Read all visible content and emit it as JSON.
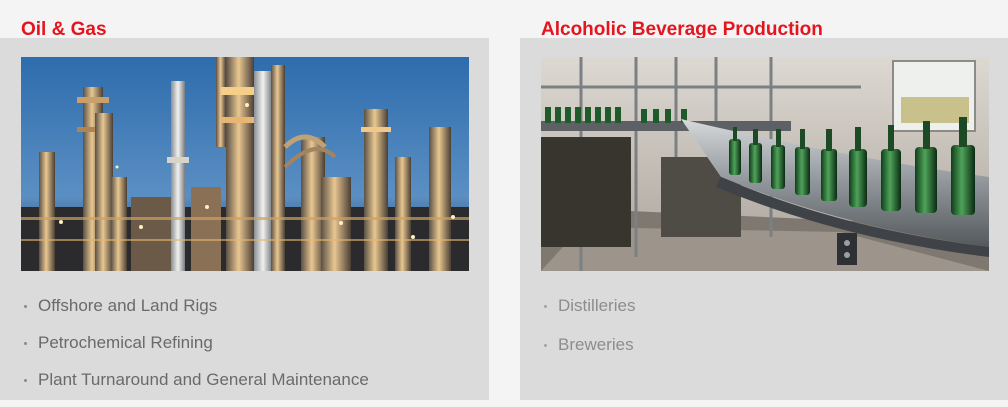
{
  "sections": [
    {
      "title": "Oil & Gas",
      "image_subject": "oil-refinery-at-dusk",
      "items": [
        "Offshore and Land Rigs",
        "Petrochemical Refining",
        "Plant Turnaround and General Maintenance"
      ]
    },
    {
      "title": "Alcoholic Beverage Production",
      "image_subject": "bottling-line-conveyor",
      "items": [
        "Distilleries",
        "Breweries"
      ]
    }
  ],
  "colors": {
    "accent": "#e4151f",
    "card_background": "#dbdbdb",
    "page_background": "#f4f4f4",
    "text_primary": "#6a6a6a",
    "text_secondary": "#8d8d8d"
  }
}
